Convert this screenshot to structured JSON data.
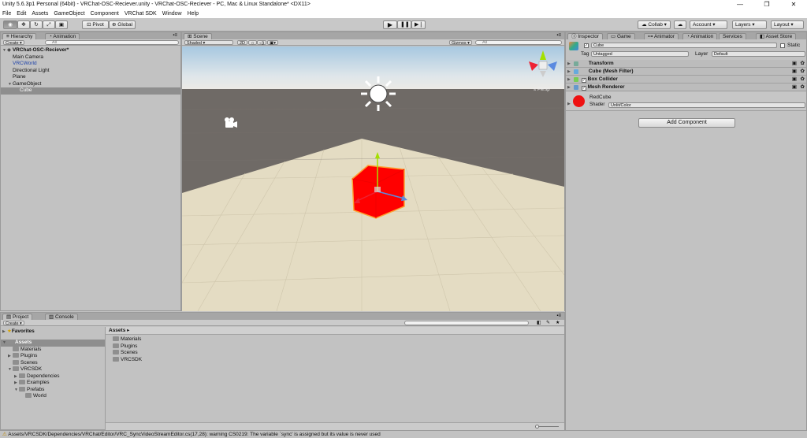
{
  "window": {
    "title": "Unity 5.6.3p1 Personal (64bit) - VRChat-OSC-Reciever.unity - VRChat-OSC-Reciever - PC, Mac & Linux Standalone* <DX11>"
  },
  "menu": [
    "File",
    "Edit",
    "Assets",
    "GameObject",
    "Component",
    "VRChat SDK",
    "Window",
    "Help"
  ],
  "toolbar": {
    "pivot": "Pivot",
    "global": "Global",
    "collab": "Collab ▾",
    "account": "Account",
    "layers": "Layers",
    "layout": "Layout"
  },
  "hierarchy": {
    "tab": "Hierarchy",
    "tab2": "Animation",
    "create": "Create ▾",
    "search_placeholder": "All",
    "scene": "VRChat-OSC-Reciever*",
    "items": [
      {
        "label": "Main Camera",
        "indent": 1
      },
      {
        "label": "VRCWorld",
        "indent": 1,
        "blue": true
      },
      {
        "label": "Directional Light",
        "indent": 1
      },
      {
        "label": "Plane",
        "indent": 1
      },
      {
        "label": "GameObject",
        "indent": 1,
        "expanded": true
      },
      {
        "label": "Cube",
        "indent": 2,
        "selected": true
      }
    ]
  },
  "scene": {
    "tab": "Scene",
    "shading": "Shaded",
    "mode2d": "2D",
    "gizmos": "Gizmos ▾",
    "search_placeholder": "All",
    "persp": "≤ Persp"
  },
  "inspector": {
    "tabs": [
      "Inspector",
      "Game",
      "Animator",
      "Animation",
      "Services",
      "Asset Store"
    ],
    "object_name": "Cube",
    "static_label": "Static",
    "tag_label": "Tag",
    "tag_value": "Untagged",
    "layer_label": "Layer",
    "layer_value": "Default",
    "components": [
      "Transform",
      "Cube (Mesh Filter)",
      "Box Collider",
      "Mesh Renderer"
    ],
    "material_name": "RedCube",
    "shader_label": "Shader",
    "shader_value": "Unlit/Color",
    "add_component": "Add Component",
    "material_color": "#ee1111"
  },
  "project": {
    "tab": "Project",
    "tab2": "Console",
    "create": "Create ▾",
    "favorites": "Favorites",
    "tree": [
      {
        "label": "Assets",
        "indent": 0,
        "selected": true,
        "bold": true
      },
      {
        "label": "Materials",
        "indent": 1
      },
      {
        "label": "Plugins",
        "indent": 1
      },
      {
        "label": "Scenes",
        "indent": 1
      },
      {
        "label": "VRCSDK",
        "indent": 1
      },
      {
        "label": "Dependencies",
        "indent": 2
      },
      {
        "label": "Examples",
        "indent": 2
      },
      {
        "label": "Prefabs",
        "indent": 2
      },
      {
        "label": "World",
        "indent": 3
      }
    ],
    "breadcrumb": "Assets ▸",
    "contents": [
      "Materials",
      "Plugins",
      "Scenes",
      "VRCSDK"
    ]
  },
  "status": {
    "message": "Assets/VRCSDK/Dependencies/VRChat/Editor/VRC_SyncVideoStreamEditor.cs(17,28): warning CS0219: The variable `sync' is assigned but its value is never used"
  }
}
